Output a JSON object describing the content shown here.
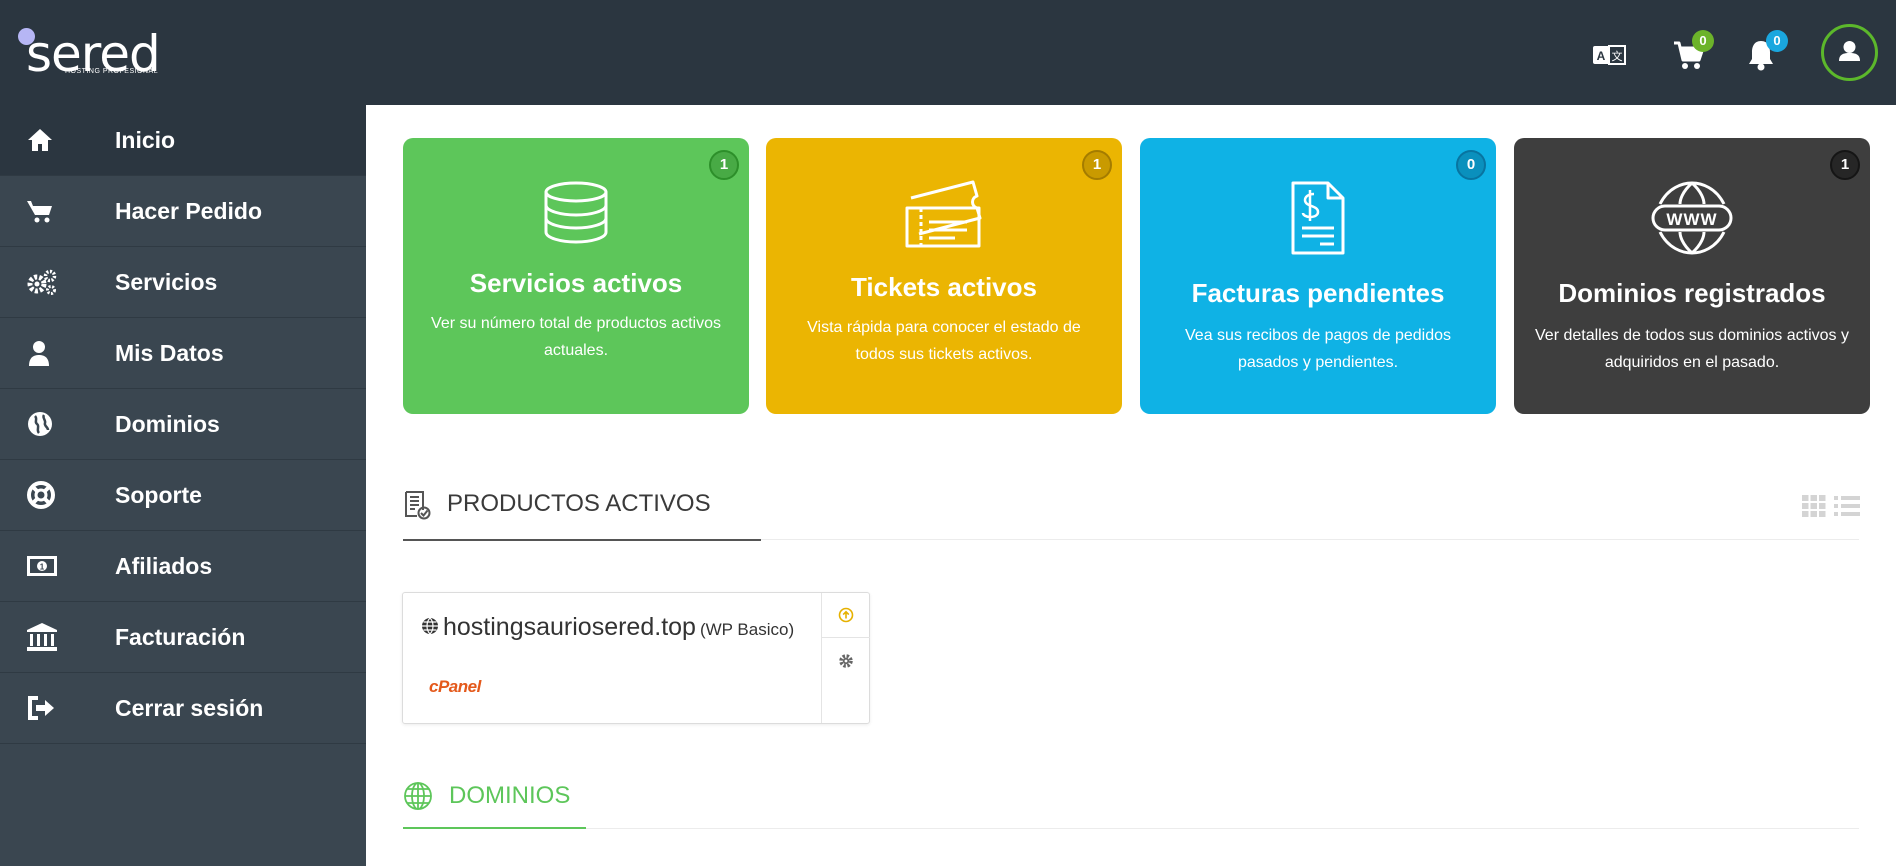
{
  "brand": {
    "name": "sered",
    "tagline": "HOSTING PROFESIONAL"
  },
  "header": {
    "cart_count": "0",
    "notifications_count": "0",
    "icons": [
      "translate-icon",
      "cart-icon",
      "bell-icon",
      "user-icon"
    ],
    "colors": {
      "cart_badge": "#6cb32a",
      "bell_badge": "#1aa7df",
      "avatar_ring": "#5cb82b"
    }
  },
  "sidebar": {
    "items": [
      {
        "label": "Inicio",
        "icon": "home-icon",
        "active": true
      },
      {
        "label": "Hacer Pedido",
        "icon": "cart-icon"
      },
      {
        "label": "Servicios",
        "icon": "gears-icon"
      },
      {
        "label": "Mis Datos",
        "icon": "user-icon"
      },
      {
        "label": "Dominios",
        "icon": "globe-icon"
      },
      {
        "label": "Soporte",
        "icon": "lifebuoy-icon"
      },
      {
        "label": "Afiliados",
        "icon": "money-icon"
      },
      {
        "label": "Facturación",
        "icon": "bank-icon"
      },
      {
        "label": "Cerrar sesión",
        "icon": "logout-icon"
      }
    ]
  },
  "cards": [
    {
      "count": "1",
      "title": "Servicios activos",
      "desc": "Ver su número total de productos activos actuales.",
      "color": "#5dc65a",
      "icon": "database-icon"
    },
    {
      "count": "1",
      "title": "Tickets activos",
      "desc": "Vista rápida para conocer el estado de todos sus tickets activos.",
      "color": "#ebb502",
      "icon": "ticket-icon"
    },
    {
      "count": "0",
      "title": "Facturas pendientes",
      "desc": "Vea sus recibos de pagos de pedidos pasados y pendientes.",
      "color": "#0fb2e5",
      "icon": "invoice-icon"
    },
    {
      "count": "1",
      "title": "Dominios registrados",
      "desc": "Ver detalles de todos sus dominios activos y adquiridos en el pasado.",
      "color": "#3e3e3e",
      "icon": "www-icon"
    }
  ],
  "products_section": {
    "title": "PRODUCTOS ACTIVOS",
    "items": [
      {
        "domain": "hostingsauriosered.top",
        "plan": "(WP Basico)",
        "panel": "cPanel"
      }
    ]
  },
  "domains_section": {
    "title": "DOMINIOS"
  }
}
